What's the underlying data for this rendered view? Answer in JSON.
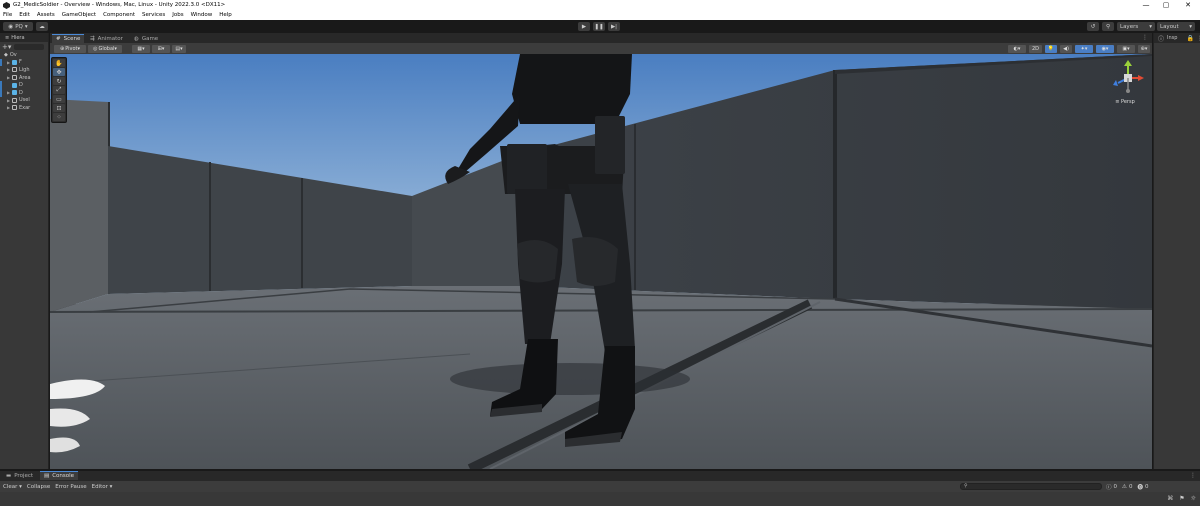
{
  "window": {
    "title": "G2_MedicSoldier - Overview - Windows, Mac, Linux - Unity 2022.3.0 <DX11>",
    "minimize": "—",
    "maximize": "▢",
    "close": "✕"
  },
  "menu": [
    "File",
    "Edit",
    "Assets",
    "GameObject",
    "Component",
    "Services",
    "Jobs",
    "Window",
    "Help"
  ],
  "toolbar": {
    "account": "PQ",
    "layers": "Layers",
    "layout": "Layout",
    "play_icon": "play-icon",
    "pause_icon": "pause-icon",
    "step_icon": "step-icon"
  },
  "hierarchy": {
    "tab": "Hiera",
    "root": "Ov",
    "items": [
      {
        "label": "F",
        "blue": true
      },
      {
        "label": "Ligh",
        "blue": false
      },
      {
        "label": "Area",
        "blue": false
      },
      {
        "label": "D",
        "blue": true
      },
      {
        "label": "D",
        "blue": true
      },
      {
        "label": "Usel",
        "blue": false
      },
      {
        "label": "Exar",
        "blue": false
      }
    ]
  },
  "scene_tabs": [
    {
      "label": "Scene",
      "icon": "scene-icon",
      "active": true
    },
    {
      "label": "Animator",
      "icon": "animator-icon",
      "active": false
    },
    {
      "label": "Game",
      "icon": "game-icon",
      "active": false
    }
  ],
  "scene_toolbar": {
    "pivot": "Pivot",
    "global": "Global",
    "mode_2d": "2D"
  },
  "viewport": {
    "projection": "Persp",
    "sky_top": "#4a7ec1",
    "sky_bottom": "#b4cde3",
    "wall_color": "#3b4046",
    "floor_color": "#585d63"
  },
  "inspector": {
    "tab": "Insp"
  },
  "console": {
    "project_tab": "Project",
    "console_tab": "Console",
    "clear": "Clear",
    "collapse": "Collapse",
    "error_pause": "Error Pause",
    "editor": "Editor",
    "log_count": "0",
    "warn_count": "0",
    "error_count": "0"
  },
  "colors": {
    "accent_blue": "#4a7ec4",
    "selection_blue": "#3a79bb",
    "panel": "#383838",
    "dark": "#191919"
  }
}
